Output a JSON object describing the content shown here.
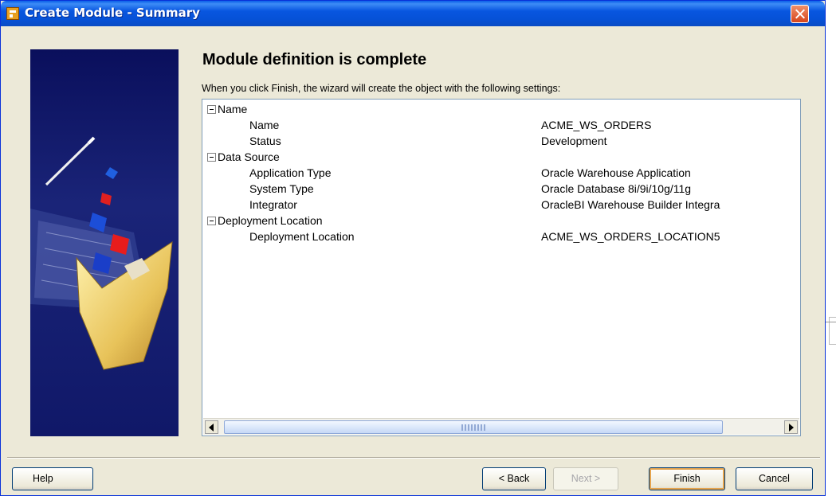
{
  "window": {
    "title": "Create Module - Summary"
  },
  "page": {
    "heading": "Module definition is complete",
    "intro": "When you click Finish, the wizard will create the object with the following settings:"
  },
  "settings": [
    {
      "group": "Name",
      "items": [
        {
          "label": "Name",
          "value": "ACME_WS_ORDERS"
        },
        {
          "label": "Status",
          "value": "Development"
        }
      ]
    },
    {
      "group": "Data Source",
      "items": [
        {
          "label": "Application Type",
          "value": "Oracle Warehouse Application"
        },
        {
          "label": "System Type",
          "value": "Oracle Database 8i/9i/10g/11g"
        },
        {
          "label": "Integrator",
          "value": "OracleBI Warehouse Builder Integra"
        }
      ]
    },
    {
      "group": "Deployment Location",
      "items": [
        {
          "label": "Deployment Location",
          "value": "ACME_WS_ORDERS_LOCATION5"
        }
      ]
    }
  ],
  "buttons": {
    "help": "Help",
    "back": "< Back",
    "next": "Next >",
    "finish": "Finish",
    "cancel": "Cancel"
  },
  "icons": {
    "app": "wizard-app-icon",
    "close": "close-icon",
    "expander": "minus-box-icon"
  },
  "colors": {
    "titlebar": "#0a4cc4",
    "dialog_bg": "#ece9d8",
    "close": "#d6451c",
    "side_panel": "#101868"
  }
}
